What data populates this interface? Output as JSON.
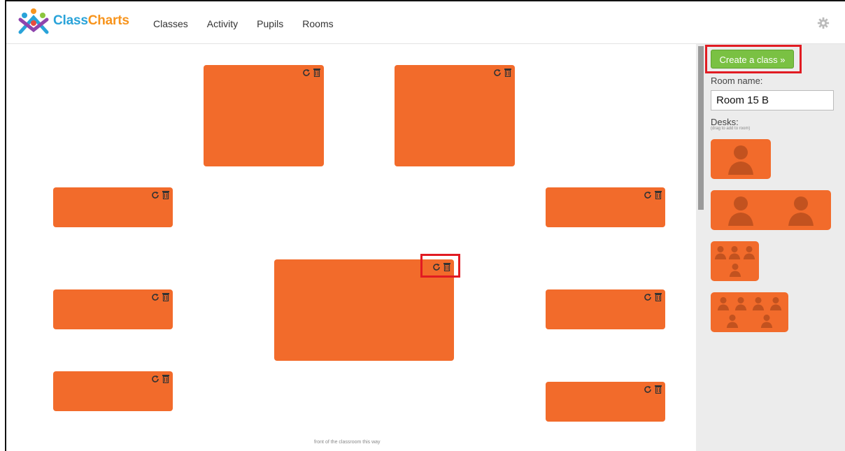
{
  "app": {
    "logo_part1": "Class",
    "logo_part2": "Charts"
  },
  "nav": {
    "items": [
      "Classes",
      "Activity",
      "Pupils",
      "Rooms"
    ]
  },
  "room": {
    "front_label": "front of the classroom this way"
  },
  "panel": {
    "create_label": "Create a class »",
    "room_name_label": "Room name:",
    "room_name_value": "Room 15 B",
    "desks_label": "Desks:",
    "desks_hint": "(drag to add to room)"
  },
  "colors": {
    "desk": "#f26b2b",
    "button": "#7ac143",
    "highlight": "#e11b22"
  }
}
